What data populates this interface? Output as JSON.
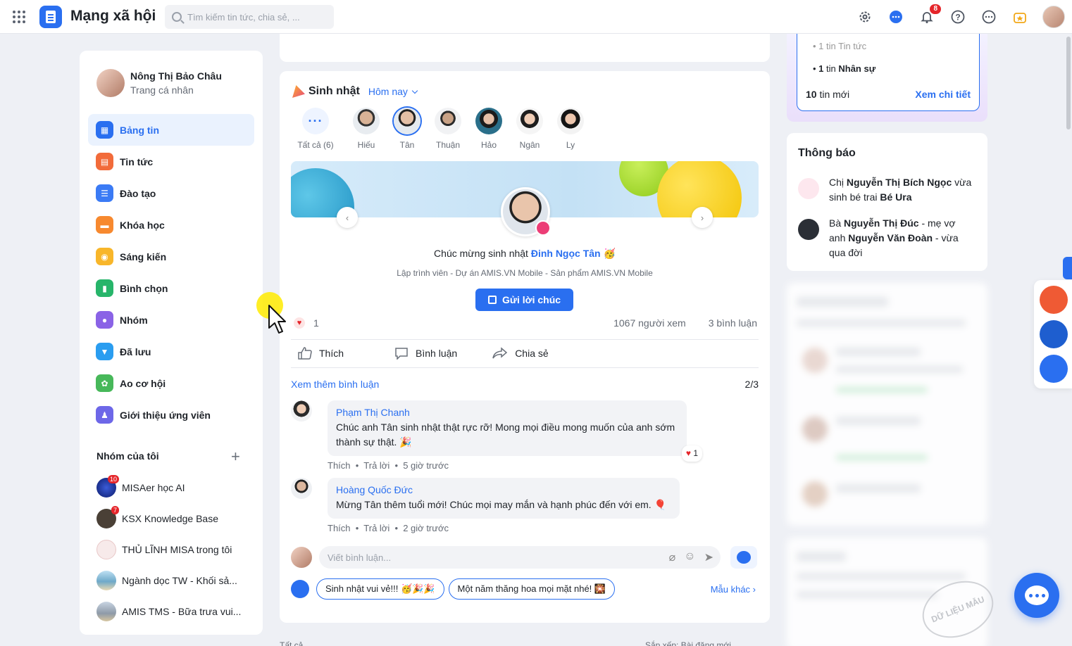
{
  "topbar": {
    "app_title": "Mạng xã hội",
    "search_placeholder": "Tìm kiếm tin tức, chia sẻ, ...",
    "notification_count": "8",
    "icons": [
      "settings-icon",
      "chat-icon",
      "bell-icon",
      "help-icon",
      "more-icon",
      "award-icon"
    ]
  },
  "sidebar": {
    "profile_name": "Nông Thị Bảo Châu",
    "profile_link": "Trang cá nhân",
    "nav": [
      {
        "label": "Bảng tin",
        "color": "#2a6ff0",
        "active": true
      },
      {
        "label": "Tin tức",
        "color": "#f26b3a"
      },
      {
        "label": "Đào tạo",
        "color": "#3b7bf5"
      },
      {
        "label": "Khóa học",
        "color": "#f7892f"
      },
      {
        "label": "Sáng kiến",
        "color": "#f8b62a"
      },
      {
        "label": "Bình chọn",
        "color": "#27b56a"
      },
      {
        "label": "Nhóm",
        "color": "#8a63e6"
      },
      {
        "label": "Đã lưu",
        "color": "#2a9df0"
      },
      {
        "label": "Ao cơ hội",
        "color": "#47b85a"
      },
      {
        "label": "Giới thiệu ứng viên",
        "color": "#6d67e8"
      }
    ],
    "groups_title": "Nhóm của tôi",
    "groups_add": "+",
    "groups": [
      {
        "label": "MISAer học AI",
        "badge": "10"
      },
      {
        "label": "KSX Knowledge Base",
        "badge": "7"
      },
      {
        "label": "THỦ LĨNH MISA trong tôi",
        "badge": ""
      },
      {
        "label": "Ngành dọc TW - Khối sả...",
        "badge": ""
      },
      {
        "label": "AMIS TMS - Bữa trưa vui...",
        "badge": ""
      }
    ]
  },
  "birthday": {
    "title": "Sinh nhật",
    "filter": "Hôm nay",
    "all_label": "Tất cả (6)",
    "all_icon": "···",
    "people": [
      "Hiếu",
      "Tân",
      "Thuận",
      "Hảo",
      "Ngân",
      "Ly"
    ],
    "congrats_prefix": "Chúc mừng sinh nhật",
    "congrats_name": "Đinh Ngọc Tân",
    "role": "Lập trình viên - Dự án AMIS.VN Mobile - Sản phẩm AMIS.VN Mobile",
    "send_button": "Gửi lời chúc",
    "reactions": "1",
    "views": "1067 người xem",
    "comments_count": "3 bình luận",
    "like": "Thích",
    "comment": "Bình luận",
    "share": "Chia sẻ",
    "more_comments": "Xem thêm bình luận",
    "page": "2/3"
  },
  "comments": [
    {
      "name": "Phạm Thị Chanh",
      "text": "Chúc anh Tân sinh nhật thật rực rỡ! Mong mọi điều mong muốn của anh sớm thành sự thật. 🎉",
      "like": "Thích",
      "reply": "Trả lời",
      "time": "5 giờ trước",
      "reactions": "1"
    },
    {
      "name": "Hoàng Quốc Đức",
      "text": "Mừng Tân thêm tuổi mới! Chúc mọi may mắn và hạnh phúc đến với em. 🎈",
      "like": "Thích",
      "reply": "Trả lời",
      "time": "2 giờ trước"
    }
  ],
  "composer": {
    "placeholder": "Viết bình luận...",
    "chips": [
      "Sinh nhật vui vẻ!!! 🥳🎉🎉",
      "Một năm thăng hoa mọi mặt nhé! 🎇"
    ],
    "more": "Mẫu khác ›"
  },
  "below": {
    "left": "Tất cả",
    "right": "Sắp xếp: Bài đăng mới"
  },
  "news": {
    "line1": "• 1 tin Tin tức",
    "line2_prefix": "• ",
    "line2_bold": "1",
    "line2_suffix": " tin ",
    "line2_cat": "Nhân sự",
    "count_bold": "10",
    "count_suffix": " tin mới",
    "more": "Xem chi tiết"
  },
  "notifications": {
    "title": "Thông báo",
    "items": [
      {
        "p1": "Chị ",
        "b1": "Nguyễn Thị Bích Ngọc",
        "p2": " vừa sinh bé trai ",
        "b2": "Bé Ura",
        "p3": ""
      },
      {
        "p1": "Bà ",
        "b1": "Nguyễn Thị Đúc",
        "p2": " - mẹ vợ anh ",
        "b2": "Nguyễn Văn Đoàn",
        "p3": " - vừa qua đời"
      }
    ]
  },
  "watermark": "DỮ LIỆU MẪU"
}
